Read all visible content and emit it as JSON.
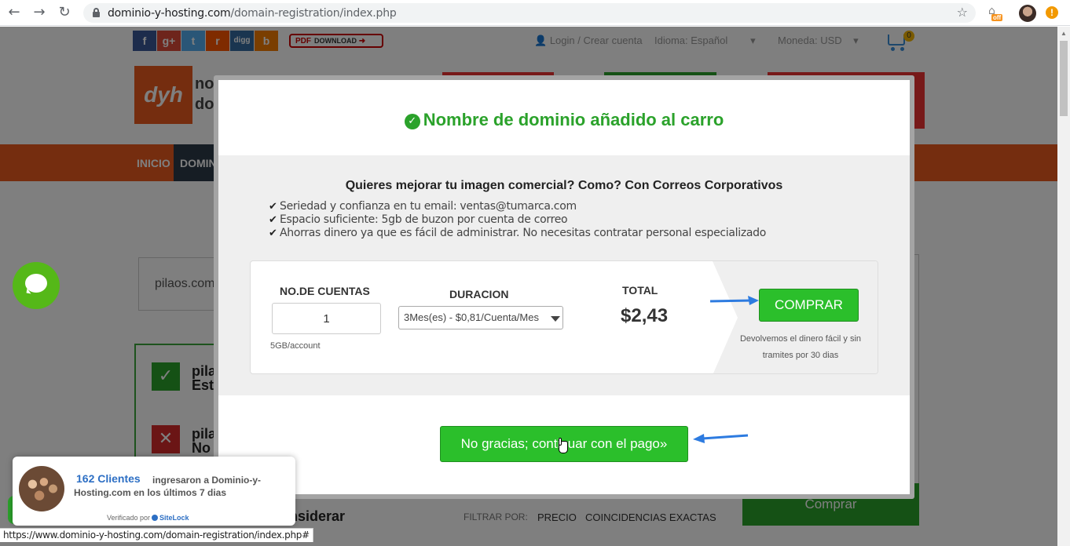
{
  "browser": {
    "url_domain": "dominio-y-hosting.com",
    "url_path": "/domain-registration/index.php",
    "ext_tag": "off",
    "status_url": "https://www.dominio-y-hosting.com/domain-registration/index.php#"
  },
  "topbar": {
    "social": [
      {
        "label": "f",
        "color": "#3b5998"
      },
      {
        "label": "g+",
        "color": "#dd4b39"
      },
      {
        "label": "t",
        "color": "#55acee"
      },
      {
        "label": "r",
        "color": "#ff5700"
      },
      {
        "label": "digg",
        "color": "#356aa0"
      },
      {
        "label": "b",
        "color": "#f57d00"
      }
    ],
    "pdf_label": "PDF",
    "pdf_sub": "DOWNLOAD",
    "login": "Login / Crear cuenta",
    "language": "Idioma:  Español",
    "currency": "Moneda:  USD",
    "cart_count": "0"
  },
  "header": {
    "logo": "dyh",
    "logo_text_1": "no",
    "logo_text_2": "do"
  },
  "nav": {
    "inicio": "INICIO",
    "domin": "DOMIN"
  },
  "background": {
    "search_value": "pilaos.com",
    "res1_line1": "pila",
    "res1_line2": "Est",
    "res2_line1": "pila",
    "res2_line2": "No",
    "considerar": "nsiderar",
    "filtrar": "FILTRAR POR:",
    "precio": "PRECIO",
    "coincidencias": "COINCIDENCIAS EXACTAS",
    "comprar": "Comprar"
  },
  "modal": {
    "title": "Nombre de dominio añadido al carro",
    "upsell_title": "Quieres mejorar tu imagen comercial? Como? Con Correos Corporativos",
    "benefits": [
      "Seriedad y confianza en tu email: ventas@tumarca.com",
      "Espacio suficiente: 5gb de buzon por cuenta de correo",
      "Ahorras dinero ya que es fácil de administrar. No necesitas contratar personal especializado"
    ],
    "accounts_label": "NO.DE CUENTAS",
    "accounts_value": "1",
    "accounts_note": "5GB/account",
    "duration_label": "DURACION",
    "duration_value": "3Mes(es) - $0,81/Cuenta/Mes",
    "total_label": "TOTAL",
    "total_value": "$2,43",
    "buy_label": "COMPRAR",
    "guarantee": "Devolvemos el dinero fácil y sin tramites por 30 dias",
    "continue_label": "No gracias; continuar con el pago»"
  },
  "proof": {
    "count": "162 Clientes",
    "message": "ingresaron a Dominio-y-Hosting.com en los últimos 7 dias",
    "verified_prefix": "Verificado por",
    "verified_brand": "SiteLock"
  },
  "colors": {
    "accent_green": "#2ba22b",
    "brand_orange": "#ea5a1f",
    "arrow_blue": "#2d7be0"
  }
}
